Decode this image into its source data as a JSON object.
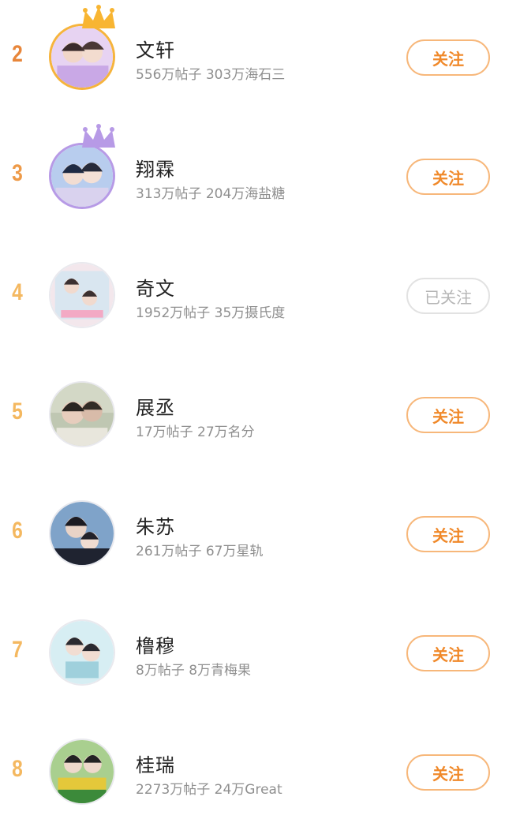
{
  "colors": {
    "rank_2": "#e8863a",
    "rank_3": "#ee9a48",
    "rank_4_plus": "#f4b860",
    "follow_text": "#f0892a",
    "follow_border": "#f7b77a",
    "followed_text": "#b5b5b5"
  },
  "rows": [
    {
      "rank": "2",
      "name": "文轩",
      "stats": "556万帖子 303万海石三",
      "button": "关注",
      "followed": false,
      "crown": "gold-crown-icon"
    },
    {
      "rank": "3",
      "name": "翔霖",
      "stats": "313万帖子 204万海盐糖",
      "button": "关注",
      "followed": false,
      "crown": "purple-crown-icon"
    },
    {
      "rank": "4",
      "name": "奇文",
      "stats": "1952万帖子 35万摄氏度",
      "button": "已关注",
      "followed": true
    },
    {
      "rank": "5",
      "name": "展丞",
      "stats": "17万帖子 27万名分",
      "button": "关注",
      "followed": false
    },
    {
      "rank": "6",
      "name": "朱苏",
      "stats": "261万帖子 67万星轨",
      "button": "关注",
      "followed": false
    },
    {
      "rank": "7",
      "name": "橹穆",
      "stats": "8万帖子 8万青梅果",
      "button": "关注",
      "followed": false
    },
    {
      "rank": "8",
      "name": "桂瑞",
      "stats": "2273万帖子 24万Great",
      "button": "关注",
      "followed": false
    }
  ]
}
